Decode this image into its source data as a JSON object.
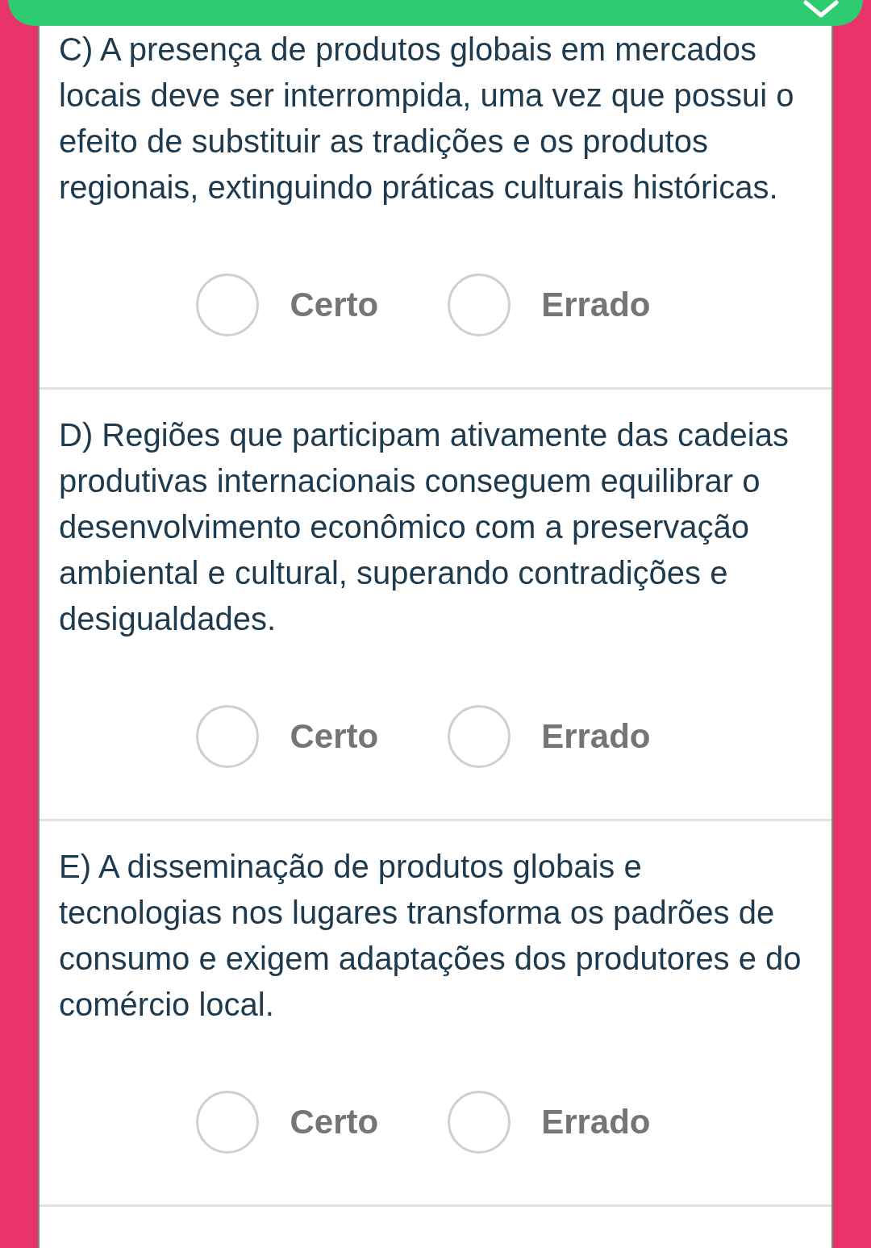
{
  "questions": [
    {
      "text": "C) A presença de produtos globais em mercados locais deve ser interrompida, uma vez que possui o efeito de substituir as tradições e os produtos regionais, extinguindo práticas culturais históricas.",
      "options": [
        {
          "label": "Certo",
          "selected": false
        },
        {
          "label": "Errado",
          "selected": false
        }
      ]
    },
    {
      "text": "D) Regiões que participam ativamente das cadeias produtivas internacionais conseguem equilibrar o desenvolvimento econômico com a preservação ambiental e cultural, superando contradições e desigualdades.",
      "options": [
        {
          "label": "Certo",
          "selected": false
        },
        {
          "label": "Errado",
          "selected": false
        }
      ]
    },
    {
      "text": "E) A disseminação de produtos globais e tecnologias nos lugares transforma os padrões de consumo e exigem adaptações dos produtores e do comércio local.",
      "options": [
        {
          "label": "Certo",
          "selected": false
        },
        {
          "label": "Errado",
          "selected": false
        }
      ]
    }
  ]
}
